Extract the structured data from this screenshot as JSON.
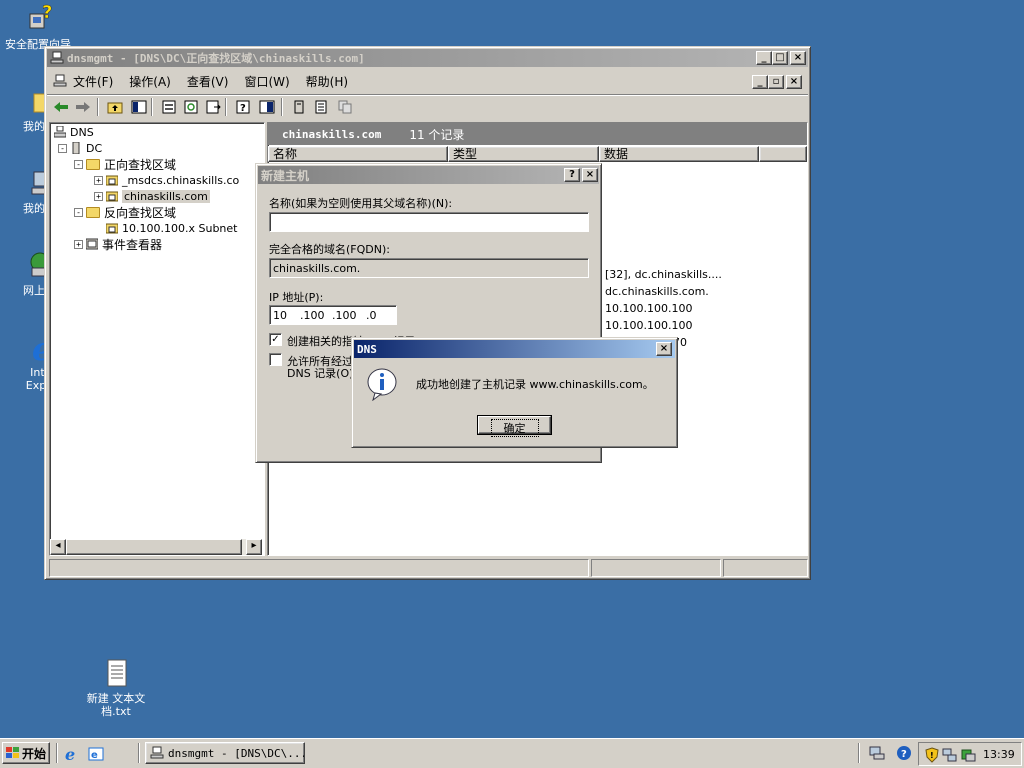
{
  "desktop": {
    "icons": [
      {
        "label": "安全配置向导",
        "icon": "security-wizard-icon"
      },
      {
        "label": "我的文",
        "icon": "my-documents-icon"
      },
      {
        "label": "我的电",
        "icon": "my-computer-icon"
      },
      {
        "label": "网上邻",
        "icon": "network-icon"
      },
      {
        "label": "Inter",
        "label2": "Explo",
        "icon": "internet-explorer-icon"
      },
      {
        "label": "新建 文本文",
        "label2": "档.txt",
        "icon": "text-file-icon"
      }
    ]
  },
  "main_window": {
    "title": "dnsmgmt - [DNS\\DC\\正向查找区域\\chinaskills.com]",
    "menu": [
      "文件(F)",
      "操作(A)",
      "查看(V)",
      "窗口(W)",
      "帮助(H)"
    ],
    "tree": {
      "root": "DNS",
      "server": "DC",
      "forward_zones": "正向查找区域",
      "msdcs_zone": "_msdcs.chinaskills.co",
      "selected_zone": "chinaskills.com",
      "reverse_zones": "反向查找区域",
      "reverse_zone": "10.100.100.x Subnet",
      "event_viewer": "事件查看器"
    },
    "list": {
      "zone_name": "chinaskills.com",
      "record_count": "11 个记录",
      "columns": [
        "名称",
        "类型",
        "数据"
      ],
      "visible_data": [
        "[32], dc.chinaskills....",
        "dc.chinaskills.com.",
        "10.100.100.100",
        "10.100.100.100",
        "70"
      ]
    }
  },
  "new_host_dialog": {
    "title": "新建主机",
    "name_label": "名称(如果为空则使用其父域名称)(N):",
    "name_value": "",
    "fqdn_label": "完全合格的域名(FQDN):",
    "fqdn_value": "chinaskills.com.",
    "ip_label": "IP 地址(P):",
    "ip_octets": [
      "10",
      ".100",
      ".100",
      ".0"
    ],
    "checkbox1_label": "创建相关的指针(PTR)记录(C)",
    "checkbox1_checked": true,
    "checkbox2_label": "允许所有经过身份验证的用户用相同的所有者名称来更新",
    "checkbox2_label_line2": "DNS 记录(O)",
    "checkbox2_checked": false
  },
  "message_box": {
    "title": "DNS",
    "message": "成功地创建了主机记录 www.chinaskills.com。",
    "ok_label": "确定",
    "icon": "information-icon"
  },
  "taskbar": {
    "start_label": "开始",
    "task_label": "dnsmgmt - [DNS\\DC\\...",
    "clock": "13:39"
  }
}
